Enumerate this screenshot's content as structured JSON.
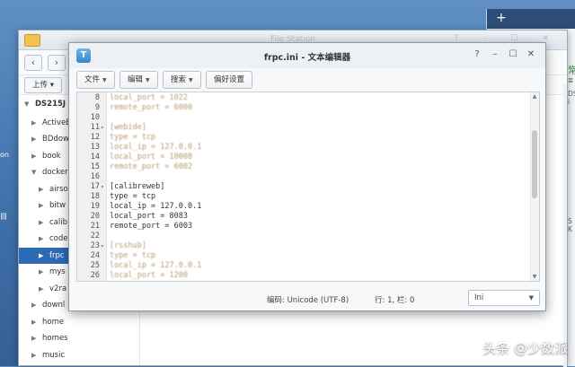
{
  "desktop": {
    "left_labels": [
      "on",
      "目"
    ]
  },
  "right_panel": {
    "plus": "+",
    "labels": [
      "常",
      "DS",
      "i",
      "≣",
      "S K"
    ]
  },
  "file_station": {
    "title": "File Station",
    "window_controls": "? – ☐ ✕",
    "back": "‹",
    "forward": "›",
    "upload_label": "上传 ▾",
    "tree": [
      {
        "label": "DS215J",
        "arrow": "▼",
        "bold": true
      },
      {
        "label": "ActiveB",
        "arrow": "▶"
      },
      {
        "label": "BDdow",
        "arrow": "▶"
      },
      {
        "label": "book",
        "arrow": "▶"
      },
      {
        "label": "docker",
        "arrow": "▼"
      },
      {
        "label": "airso",
        "arrow": "▶"
      },
      {
        "label": "bitw",
        "arrow": "▶"
      },
      {
        "label": "calib",
        "arrow": "▶"
      },
      {
        "label": "code",
        "arrow": "▶"
      },
      {
        "label": "frpc",
        "arrow": "▶",
        "selected": true
      },
      {
        "label": "mys",
        "arrow": "▶"
      },
      {
        "label": "v2ra",
        "arrow": "▶"
      },
      {
        "label": "downl",
        "arrow": "▶"
      },
      {
        "label": "home",
        "arrow": "▶"
      },
      {
        "label": "homes",
        "arrow": "▶"
      },
      {
        "label": "music",
        "arrow": "▶"
      }
    ]
  },
  "editor": {
    "logo": "T",
    "title": "frpc.ini - 文本编辑器",
    "controls": {
      "help": "?",
      "minimize": "–",
      "maximize": "☐",
      "close": "✕"
    },
    "toolbar": {
      "file": "文件",
      "edit": "编辑",
      "search": "搜索",
      "prefs": "偏好设置"
    },
    "lines": [
      {
        "n": "8",
        "text": "local_port = 1022",
        "blur": true
      },
      {
        "n": "9",
        "text": "remote_port = 6000",
        "blur": true
      },
      {
        "n": "10",
        "text": "",
        "blur": false
      },
      {
        "n": "11",
        "text": "[webide]",
        "blur": true,
        "fold": true
      },
      {
        "n": "12",
        "text": "type = tcp",
        "blur": true
      },
      {
        "n": "13",
        "text": "local_ip = 127.0.0.1",
        "blur": true
      },
      {
        "n": "14",
        "text": "local_port = 10008",
        "blur": true
      },
      {
        "n": "15",
        "text": "remote_port = 6002",
        "blur": true
      },
      {
        "n": "16",
        "text": "",
        "blur": false
      },
      {
        "n": "17",
        "text": "[calibreweb]",
        "blur": false,
        "fold": true
      },
      {
        "n": "18",
        "text": "type = tcp",
        "blur": false
      },
      {
        "n": "19",
        "text": "local_ip = 127.0.0.1",
        "blur": false
      },
      {
        "n": "20",
        "text": "local_port = 8083",
        "blur": false
      },
      {
        "n": "21",
        "text": "remote_port = 6003",
        "blur": false
      },
      {
        "n": "22",
        "text": "",
        "blur": false
      },
      {
        "n": "23",
        "text": "[rsshub]",
        "blur": true,
        "fold": true
      },
      {
        "n": "24",
        "text": "type = tcp",
        "blur": true
      },
      {
        "n": "25",
        "text": "local_ip = 127.0.0.1",
        "blur": true
      },
      {
        "n": "26",
        "text": "local_port = 1200",
        "blur": true
      }
    ],
    "status": {
      "encoding": "编码: Unicode (UTF-8)",
      "position": "行: 1, 栏: 0",
      "language": "Ini"
    }
  },
  "watermark": "头条 @少数派"
}
